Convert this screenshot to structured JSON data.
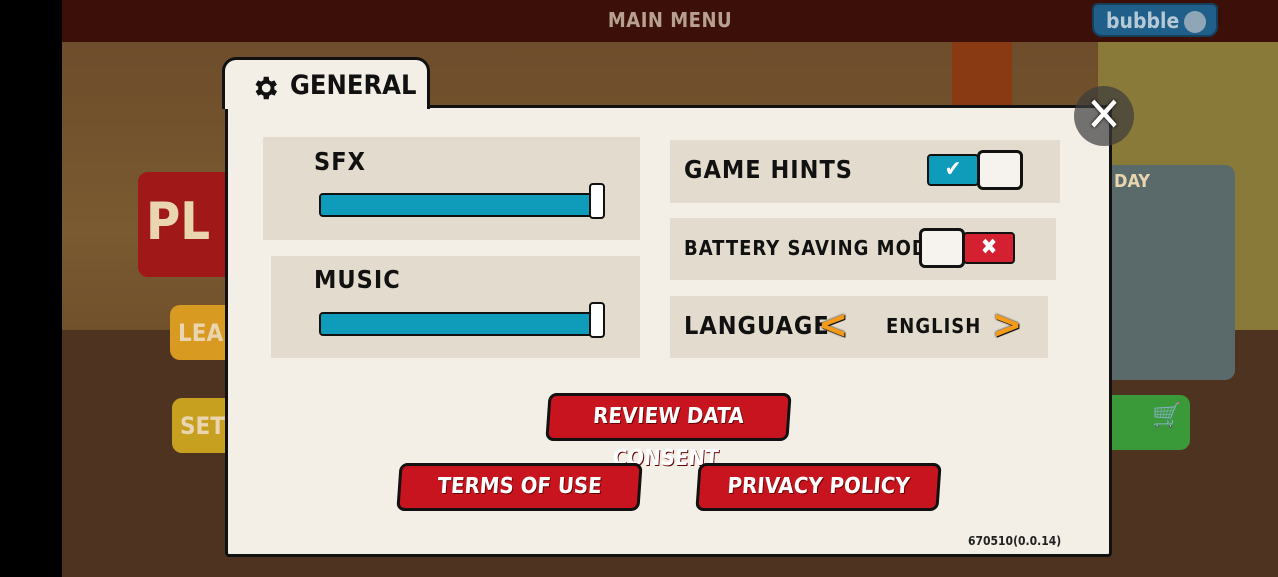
{
  "header": {
    "title": "MAIN MENU",
    "bubble_label": "bubble"
  },
  "background": {
    "play_label": "PL",
    "leaderboard_label": "LEA",
    "settings_label": "SET",
    "daily_label": "DAY"
  },
  "settings": {
    "tab_title": "GENERAL",
    "sfx": {
      "label": "SFX",
      "level": 1.0
    },
    "music": {
      "label": "MUSIC",
      "level": 1.0
    },
    "game_hints": {
      "label": "GAME HINTS",
      "enabled": true,
      "on_glyph": "✔"
    },
    "battery_saving": {
      "label": "BATTERY SAVING MODE",
      "enabled": false,
      "off_glyph": "✖"
    },
    "language": {
      "label": "LANGUAGE",
      "value": "ENGLISH",
      "prev": "<",
      "next": ">"
    },
    "review_consent_label": "REVIEW DATA CONSENT",
    "terms_label": "TERMS OF USE",
    "privacy_label": "PRIVACY POLICY",
    "version": "670510(0.0.14)",
    "close_glyph": "✕"
  },
  "colors": {
    "accent_blue": "#0f9cba",
    "button_red": "#c8141e",
    "arrow_orange": "#f39a1a"
  }
}
